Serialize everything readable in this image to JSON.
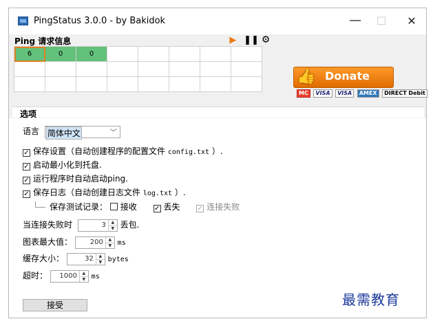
{
  "window": {
    "title": "PingStatus 3.0.0 - by Bakidok",
    "minimize": "—",
    "maximize": "☐",
    "close": "✕"
  },
  "ping": {
    "title": "Ping 请求信息",
    "tools": {
      "play": "▶",
      "pause": "❚❚",
      "settings": "⚙"
    },
    "cells": [
      "6",
      "0",
      "0",
      "",
      "",
      "",
      "",
      "",
      "",
      "",
      "",
      "",
      "",
      "",
      "",
      "",
      "",
      "",
      "",
      "",
      "",
      "",
      "",
      "",
      "",
      ""
    ]
  },
  "donate": {
    "label": "Donate",
    "cards": [
      "MC",
      "VISA",
      "VISA",
      "AMEX",
      "DIRECT Debit"
    ]
  },
  "options": {
    "title": "选项",
    "language_label": "语言",
    "language_value": "简体中文",
    "save_settings": {
      "checked": true,
      "text": "保存设置（自动创建程序的配置文件",
      "file": "config.txt",
      "suffix": "）."
    },
    "minimize_tray": {
      "checked": true,
      "text": "启动最小化到托盘."
    },
    "auto_ping": {
      "checked": true,
      "text": "运行程序时自动启动ping."
    },
    "save_log": {
      "checked": true,
      "text": "保存日志（自动创建日志文件",
      "file": "log.txt",
      "suffix": "）."
    },
    "log_record_label": "保存测试记录：",
    "log_receive": {
      "checked": false,
      "text": "接收"
    },
    "log_lost": {
      "checked": true,
      "text": "丢失"
    },
    "log_fail": {
      "checked": true,
      "text": "连接失败"
    },
    "fail_label": "当连接失败时",
    "fail_value": "3",
    "fail_unit": "丢包.",
    "chart_max_label": "图表最大值：",
    "chart_max_value": "200",
    "chart_max_unit": "ms",
    "buffer_label": "缓存大小：",
    "buffer_value": "32",
    "buffer_unit": "bytes",
    "timeout_label": "超时：",
    "timeout_value": "1000",
    "timeout_unit": "ms",
    "accept": "接受"
  },
  "watermark": "最需教育"
}
